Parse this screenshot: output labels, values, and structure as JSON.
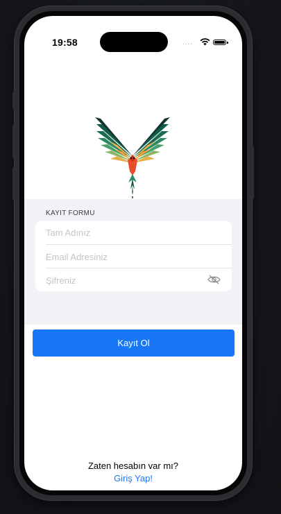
{
  "status_bar": {
    "time": "19:58",
    "signal": "....",
    "icons": [
      "signal-dots-icon",
      "wifi-icon",
      "battery-icon"
    ]
  },
  "logo": {
    "icon": "parrot-logo-icon",
    "colors": [
      "#0f5c4a",
      "#2c8a62",
      "#f4a93a",
      "#e94e2a",
      "#ff9f2e"
    ]
  },
  "form": {
    "section_title": "KAYIT FORMU",
    "name_placeholder": "Tam Adınız",
    "email_placeholder": "Email Adresiniz",
    "password_placeholder": "Şifreniz",
    "password_toggle_icon": "eye-slash-icon"
  },
  "submit": {
    "label": "Kayıt Ol"
  },
  "footer": {
    "prompt": "Zaten hesabın var mı?",
    "login_link": "Giriş Yap!"
  },
  "colors": {
    "accent": "#1877f7",
    "form_background": "#f1f1f6"
  }
}
